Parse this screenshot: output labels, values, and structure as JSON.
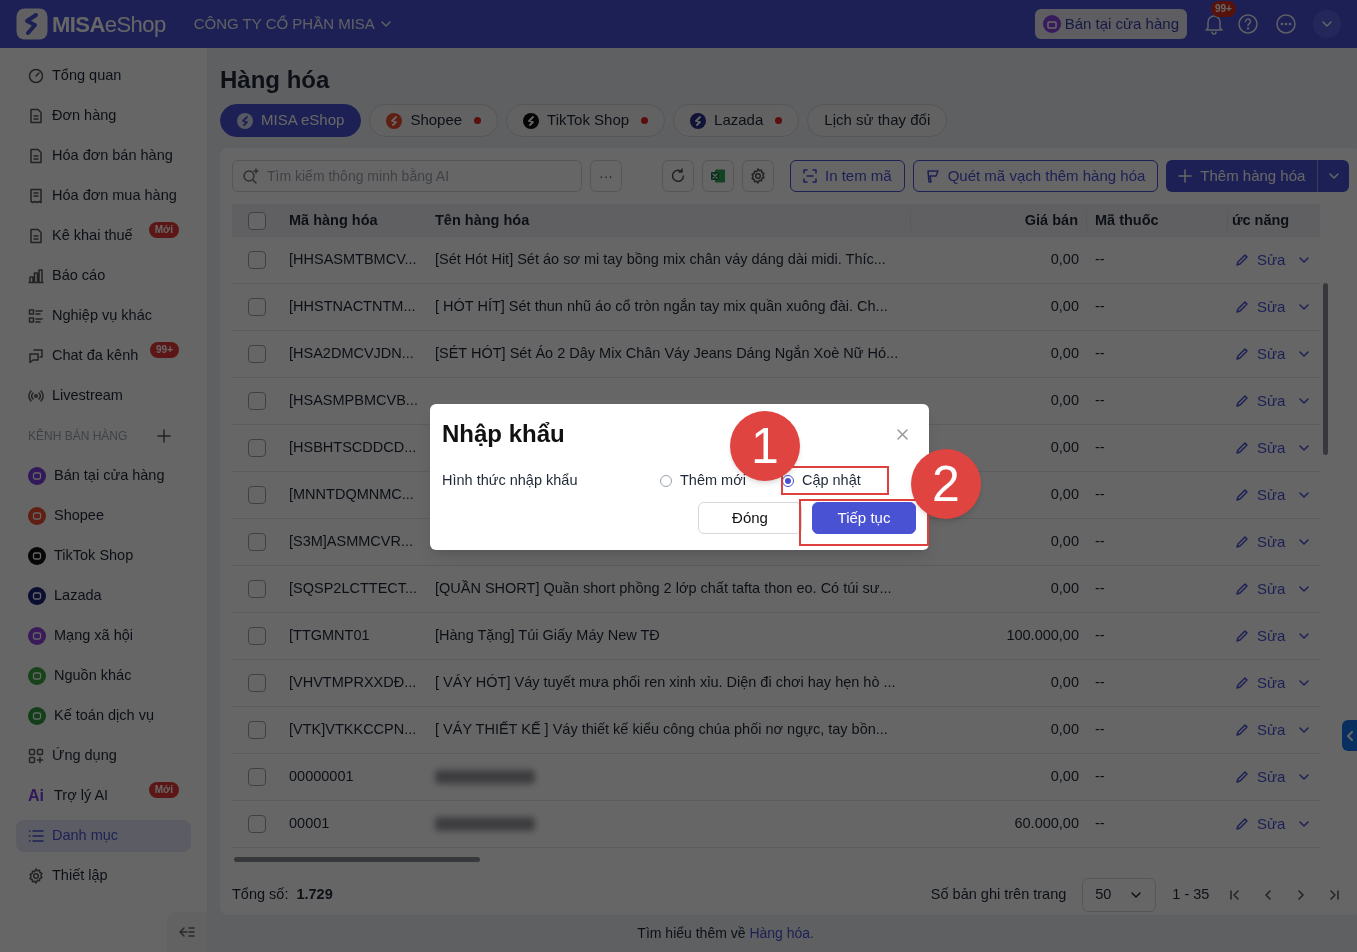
{
  "header": {
    "logo": {
      "brand": "MISA",
      "product": "eShop"
    },
    "company": "CÔNG TY CỔ PHẦN MISA",
    "store_button": "Bán tại cửa hàng",
    "notification_badge": "99+"
  },
  "sidebar": {
    "nav_top": [
      {
        "label": "Tổng quan",
        "selected": false
      },
      {
        "label": "Đơn hàng",
        "selected": false
      },
      {
        "label": "Hóa đơn bán hàng",
        "selected": false
      },
      {
        "label": "Hóa đơn mua hàng",
        "selected": false
      },
      {
        "label": "Kê khai thuế",
        "selected": false,
        "badge": "Mới"
      },
      {
        "label": "Báo cáo",
        "selected": false
      },
      {
        "label": "Nghiệp vụ khác",
        "selected": false
      },
      {
        "label": "Chat đa kênh",
        "selected": false,
        "badge": "99+"
      },
      {
        "label": "Livestream",
        "selected": false
      }
    ],
    "section_title": "KÊNH BÁN HÀNG",
    "channels": [
      {
        "label": "Bán tại cửa hàng",
        "color": "#31195b"
      },
      {
        "label": "Shopee",
        "color": "#5f1f12"
      },
      {
        "label": "TikTok Shop",
        "color": "#070707"
      },
      {
        "label": "Lazada",
        "color": "#0a0e32"
      },
      {
        "label": "Mạng xã hội",
        "color": "#391b5a"
      },
      {
        "label": "Nguồn khác",
        "color": "#17431b"
      },
      {
        "label": "Kế toán dịch vụ",
        "color": "#123f19"
      }
    ],
    "nav_bottom": [
      {
        "label": "Ứng dụng",
        "selected": false
      },
      {
        "label": "Trợ lý AI",
        "selected": false,
        "badge": "Mới",
        "icon_text": "Ai"
      },
      {
        "label": "Danh mục",
        "selected": true
      },
      {
        "label": "Thiết lập",
        "selected": false
      }
    ]
  },
  "page_title": "Hàng hóa",
  "tabs": [
    {
      "label": "MISA eShop",
      "selected": true,
      "alert": false
    },
    {
      "label": "Shopee",
      "selected": false,
      "alert": true
    },
    {
      "label": "TikTok Shop",
      "selected": false,
      "alert": true
    },
    {
      "label": "Lazada",
      "selected": false,
      "alert": true
    },
    {
      "label": "Lịch sử thay đổi",
      "selected": false,
      "alert": false
    }
  ],
  "toolbar": {
    "search_placeholder": "Tìm kiếm thông minh bằng AI",
    "more_button": "···",
    "print_button": "In tem mã",
    "scan_button": "Quét mã vạch thêm hàng hóa",
    "add_button": "Thêm hàng hóa"
  },
  "table": {
    "select_all_checked": false,
    "columns": [
      "Mã hàng hóa",
      "Tên hàng hóa",
      "Giá bán",
      "Mã thuốc",
      "ức năng"
    ],
    "rows": [
      {
        "checked": false,
        "code": "[HHSASMTBMCV...",
        "name": "[Sét Hót Hit] Sét áo sơ mi tay bồng mix chân váy dáng dài midi. Thíc...",
        "price": "0,00",
        "drug_code": "--",
        "action": "Sửa"
      },
      {
        "checked": false,
        "code": "[HHSTNACTNTM...",
        "name": "[ HÓT HÍT] Sét thun nhũ áo cổ tròn ngắn tay mix quần xuông đài. Ch...",
        "price": "0,00",
        "drug_code": "--",
        "action": "Sửa"
      },
      {
        "checked": false,
        "code": "[HSA2DMCVJDN...",
        "name": "[SÉT HÓT] Sét Áo 2 Dây Mix Chân Váy Jeans Dáng Ngắn Xoè Nữ Hó...",
        "price": "0,00",
        "drug_code": "--",
        "action": "Sửa"
      },
      {
        "checked": false,
        "code": "[HSASMPBMCVB...",
        "price": "0,00",
        "drug_code": "--",
        "action": "Sửa"
      },
      {
        "checked": false,
        "code": "[HSBHTSCDDCD...",
        "price": "0,00",
        "drug_code": "--",
        "action": "Sửa"
      },
      {
        "checked": false,
        "code": "[MNNTDQMNMC...",
        "price": "0,00",
        "drug_code": "--",
        "action": "Sửa"
      },
      {
        "checked": false,
        "code": "[S3M]ASMMCVR...",
        "price": "0,00",
        "drug_code": "--",
        "action": "Sửa"
      },
      {
        "checked": false,
        "code": "[SQSP2LCTTECT...",
        "name": "[QUẦN SHORT] Quần short phồng 2 lớp chất tafta thon eo. Có túi sư...",
        "price": "0,00",
        "drug_code": "--",
        "action": "Sửa"
      },
      {
        "checked": false,
        "code": "[TTGMNT01",
        "name": "[Hàng Tặng] Túi Giấy Máy New TĐ",
        "price": "100.000,00",
        "drug_code": "--",
        "action": "Sửa"
      },
      {
        "checked": false,
        "code": "[VHVTMPRXXDĐ...",
        "name": "[ VÁY HÓT] Váy tuyết mưa phối ren xinh xỉu. Diện đi chơi hay hẹn hò ...",
        "price": "0,00",
        "drug_code": "--",
        "action": "Sửa"
      },
      {
        "checked": false,
        "code": "[VTK]VTKKCCPN...",
        "name": "[ VÁY THIẾT KẾ ]  Váy thiết kế kiểu công chúa phối nơ ngực, tay bồn...",
        "price": "0,00",
        "drug_code": "--",
        "action": "Sửa"
      },
      {
        "checked": false,
        "code": "00000001",
        "name_blurred": true,
        "price": "0,00",
        "drug_code": "--",
        "action": "Sửa"
      },
      {
        "checked": false,
        "code": "00001",
        "name_blurred": true,
        "price": "60.000,00",
        "drug_code": "--",
        "action": "Sửa"
      }
    ],
    "total_label": "Tổng số:",
    "total": "1.729",
    "page_size_label": "Số bản ghi trên trang",
    "page_size": "50",
    "range": "1 - 35"
  },
  "footer": {
    "text": "Tìm hiểu thêm về",
    "link": "Hàng hóa."
  },
  "dialog": {
    "title": "Nhập khẩu",
    "field_label": "Hình thức nhập khẩu",
    "options": [
      {
        "label": "Thêm mới",
        "selected": false
      },
      {
        "label": "Cập nhật",
        "selected": true
      }
    ],
    "buttons": [
      {
        "label": "Đóng",
        "kind": "secondary"
      },
      {
        "label": "Tiếp tục",
        "kind": "primary"
      }
    ]
  },
  "annotations": [
    {
      "label": "1"
    },
    {
      "label": "2"
    }
  ]
}
